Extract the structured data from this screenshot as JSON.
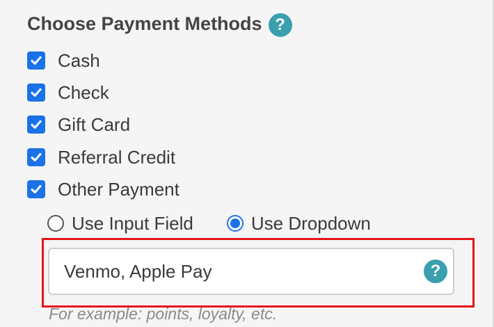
{
  "section": {
    "title": "Choose Payment Methods",
    "help_icon": "?"
  },
  "payment_methods": [
    {
      "label": "Cash",
      "checked": true
    },
    {
      "label": "Check",
      "checked": true
    },
    {
      "label": "Gift Card",
      "checked": true
    },
    {
      "label": "Referral Credit",
      "checked": true
    },
    {
      "label": "Other Payment",
      "checked": true
    }
  ],
  "other_payment_mode": {
    "options": [
      {
        "label": "Use Input Field",
        "selected": false
      },
      {
        "label": "Use Dropdown",
        "selected": true
      }
    ]
  },
  "other_payment_input": {
    "value": "Venmo, Apple Pay",
    "help_icon": "?",
    "hint": "For example: points, loyalty, etc."
  },
  "colors": {
    "accent": "#1a73e8",
    "help": "#3a9fae",
    "highlight": "#e8141a"
  }
}
